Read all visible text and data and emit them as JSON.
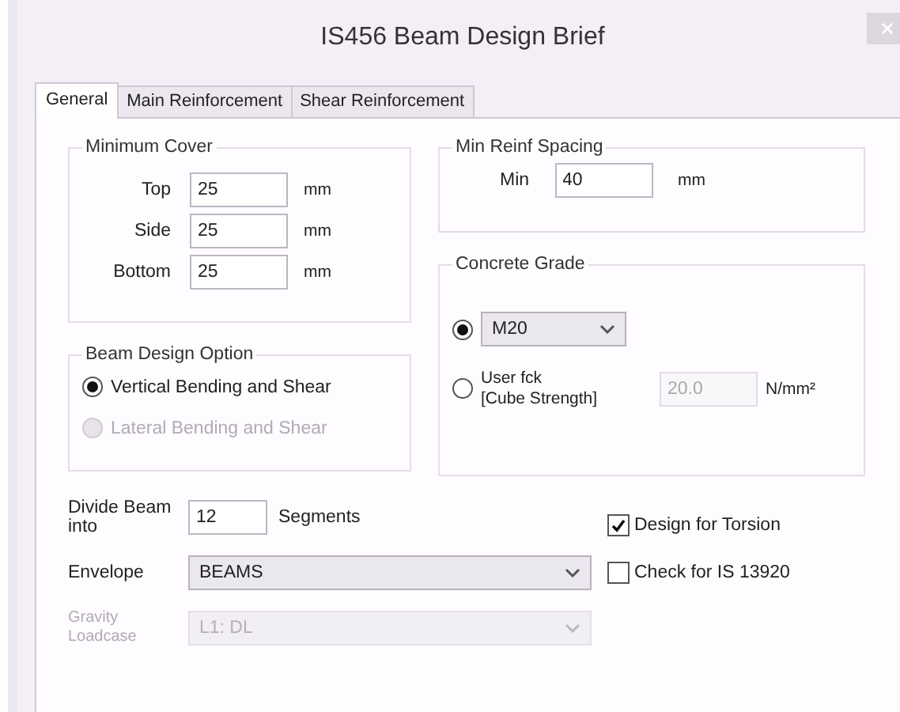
{
  "window": {
    "title": "IS456 Beam Design Brief"
  },
  "tabs": [
    {
      "label": "General",
      "selected": true
    },
    {
      "label": "Main Reinforcement",
      "selected": false
    },
    {
      "label": "Shear Reinforcement",
      "selected": false
    }
  ],
  "minimum_cover": {
    "title": "Minimum Cover",
    "rows": [
      {
        "label": "Top",
        "value": "25",
        "unit": "mm"
      },
      {
        "label": "Side",
        "value": "25",
        "unit": "mm"
      },
      {
        "label": "Bottom",
        "value": "25",
        "unit": "mm"
      }
    ]
  },
  "min_reinf_spacing": {
    "title": "Min Reinf Spacing",
    "label": "Min",
    "value": "40",
    "unit": "mm"
  },
  "concrete_grade": {
    "title": "Concrete Grade",
    "options": [
      {
        "kind": "dropdown",
        "value": "M20",
        "selected": true
      },
      {
        "kind": "custom",
        "label_lines": [
          "User fck",
          "[Cube Strength]"
        ],
        "value": "20.0",
        "unit": "N/mm²",
        "selected": false,
        "disabled": true
      }
    ]
  },
  "beam_design_option": {
    "title": "Beam Design Option",
    "options": [
      {
        "label": "Vertical Bending and Shear",
        "selected": true,
        "disabled": false
      },
      {
        "label": "Lateral Bending and Shear",
        "selected": false,
        "disabled": true
      }
    ]
  },
  "divide": {
    "label": "Divide Beam into",
    "value": "12",
    "unit": "Segments"
  },
  "envelope": {
    "label": "Envelope",
    "value": "BEAMS",
    "disabled": false
  },
  "gravity_loadcase": {
    "label_lines": [
      "Gravity",
      "Loadcase"
    ],
    "value": "L1: DL",
    "disabled": true
  },
  "checkboxes": [
    {
      "label": "Design for Torsion",
      "checked": true
    },
    {
      "label": "Check for IS 13920",
      "checked": false
    }
  ]
}
